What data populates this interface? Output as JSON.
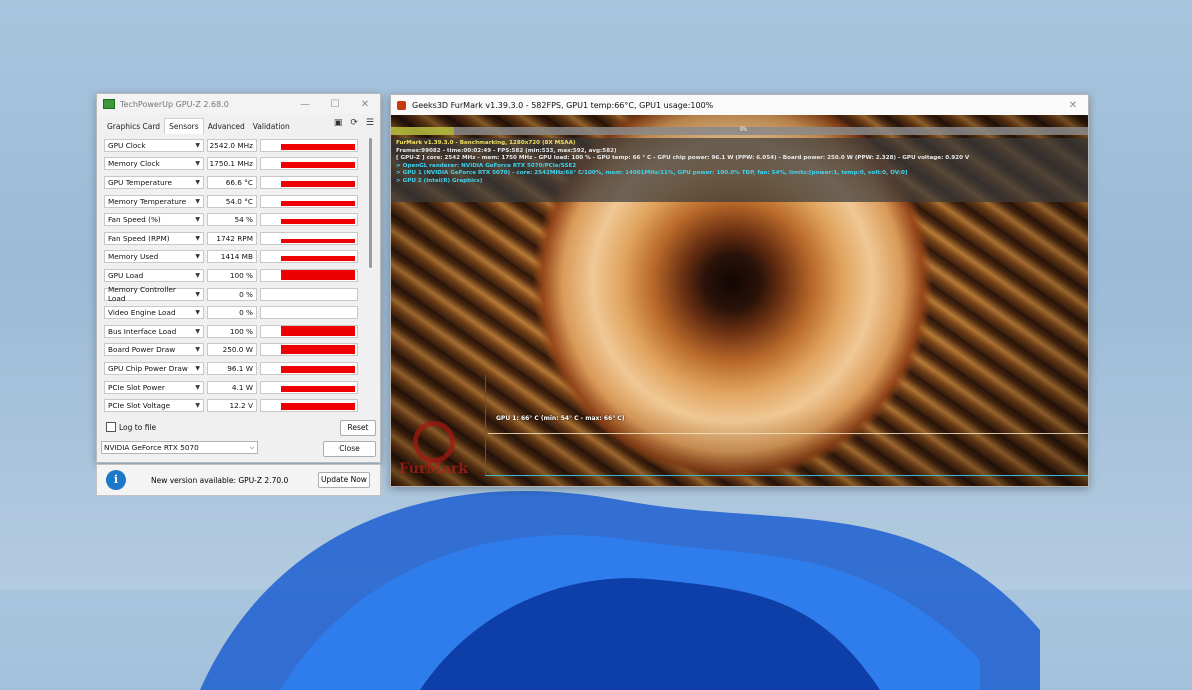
{
  "gpuz": {
    "title": "TechPowerUp GPU-Z 2.68.0",
    "tabs": [
      "Graphics Card",
      "Sensors",
      "Advanced",
      "Validation"
    ],
    "active_tab": "Sensors",
    "sensors": [
      {
        "name": "GPU Clock",
        "value": "2542.0 MHz",
        "level": 0.6
      },
      {
        "name": "Memory Clock",
        "value": "1750.1 MHz",
        "level": 0.6
      },
      {
        "name": "GPU Temperature",
        "value": "66.6 °C",
        "level": 0.55
      },
      {
        "name": "Memory Temperature",
        "value": "54.0 °C",
        "level": 0.5
      },
      {
        "name": "Fan Speed (%)",
        "value": "54 %",
        "level": 0.5
      },
      {
        "name": "Fan Speed (RPM)",
        "value": "1742 RPM",
        "level": 0.4
      },
      {
        "name": "Memory Used",
        "value": "1414 MB",
        "level": 0.45
      },
      {
        "name": "GPU Load",
        "value": "100 %",
        "level": 1.0
      },
      {
        "name": "Memory Controller Load",
        "value": "0 %",
        "level": 0.0
      },
      {
        "name": "Video Engine Load",
        "value": "0 %",
        "level": 0.0
      },
      {
        "name": "Bus Interface Load",
        "value": "100 %",
        "level": 1.0
      },
      {
        "name": "Board Power Draw",
        "value": "250.0 W",
        "level": 0.9
      },
      {
        "name": "GPU Chip Power Draw",
        "value": "96.1 W",
        "level": 0.7
      },
      {
        "name": "PCIe Slot Power",
        "value": "4.1 W",
        "level": 0.6
      },
      {
        "name": "PCIe Slot Voltage",
        "value": "12.2 V",
        "level": 0.7
      }
    ],
    "log_to_file": "Log to file",
    "reset": "Reset",
    "device": "NVIDIA GeForce RTX 5070",
    "close": "Close",
    "update_text": "New version available: GPU-Z 2.70.0",
    "update_button": "Update Now",
    "bar_color": "#ee0000"
  },
  "furmark": {
    "title": "Geeks3D FurMark v1.39.3.0 - 582FPS, GPU1 temp:66°C, GPU1 usage:100%",
    "progress_label": "9%",
    "progress": 0.09,
    "hud": [
      "FurMark v1.39.3.0 - Benchmarking, 1280x720 (8X MSAA)",
      "Frames:99082 - time:00:02:49 - FPS:582 (min:533, max:592, avg:582)",
      "[ GPU-Z ] core: 2542 MHz - mem: 1750 MHz - GPU load: 100 % - GPU temp: 66 ° C - GPU chip power: 96.1 W (PPW: 6.054) - Board power: 250.0 W (PPW: 2.328) - GPU voltage: 0.920 V",
      "> OpenGL renderer: NVIDIA GeForce RTX 5070/PCIe/SSE2",
      "> GPU 1 (NVIDIA GeForce RTX 5070) - core: 2542MHz/66° C/100%, mem: 14001MHz/11%, GPU power: 100.0% TDP, fan: 54%, limits:[power:1, temp:0, volt:0, OV:0]",
      "> GPU 2 (Intel(R) Graphics)"
    ],
    "graph_label": "GPU 1: 66° C (min: 54° C - max: 66° C)",
    "logo_text": "FurMark"
  }
}
